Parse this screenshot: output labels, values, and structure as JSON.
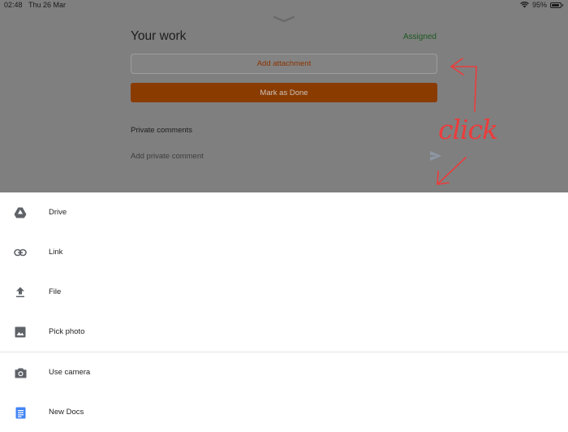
{
  "status_bar": {
    "time": "02:48",
    "date": "Thu 26 Mar",
    "battery": "95%",
    "icons": [
      "wifi-icon",
      "battery-icon"
    ]
  },
  "your_work": {
    "title": "Your work",
    "status": "Assigned",
    "add_attachment_label": "Add attachment",
    "mark_done_label": "Mark as Done",
    "private_comments_heading": "Private comments",
    "comment_placeholder": "Add private comment",
    "send_icon": "send-icon"
  },
  "annotation": {
    "text": "click",
    "color": "#ee3b3b"
  },
  "sheet": {
    "items": [
      {
        "label": "Drive",
        "icon": "drive-icon"
      },
      {
        "label": "Link",
        "icon": "link-icon"
      },
      {
        "label": "File",
        "icon": "upload-icon"
      },
      {
        "label": "Pick photo",
        "icon": "photo-icon"
      },
      {
        "label": "Use camera",
        "icon": "camera-icon"
      },
      {
        "label": "New Docs",
        "icon": "docs-icon"
      }
    ]
  },
  "colors": {
    "accent": "#8a3b00",
    "assigned": "#1c5a22",
    "docs_blue": "#4285f4",
    "overlay": "#7f7f7f"
  }
}
